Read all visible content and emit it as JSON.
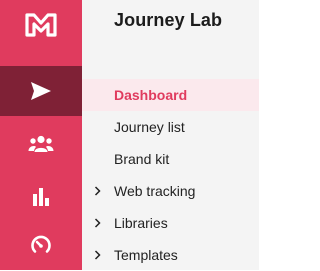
{
  "app": {
    "title": "Journey Lab"
  },
  "rail": {
    "items": [
      {
        "icon": "logo-icon"
      },
      {
        "icon": "send-icon",
        "active": true
      },
      {
        "icon": "users-icon"
      },
      {
        "icon": "bar-chart-icon"
      },
      {
        "icon": "gauge-icon"
      }
    ]
  },
  "nav": {
    "items": [
      {
        "label": "Dashboard",
        "active": true,
        "expandable": false
      },
      {
        "label": "Journey list",
        "expandable": false
      },
      {
        "label": "Brand kit",
        "expandable": false
      },
      {
        "label": "Web tracking",
        "expandable": true
      },
      {
        "label": "Libraries",
        "expandable": true
      },
      {
        "label": "Templates",
        "expandable": true
      }
    ]
  },
  "colors": {
    "brand": "#e03b5e",
    "rail_active": "#7f2136",
    "nav_active_bg": "#fbe9ed"
  }
}
